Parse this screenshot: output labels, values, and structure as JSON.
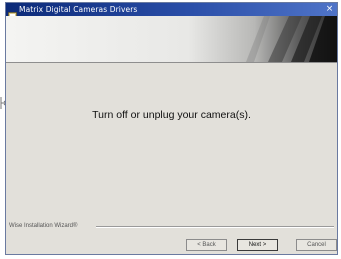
{
  "window": {
    "title": "Matrix Digital Cameras Drivers",
    "close_glyph": "×"
  },
  "main": {
    "message": "Turn off or unplug your camera(s)."
  },
  "footer": {
    "label": "Wise Installation Wizard®"
  },
  "buttons": {
    "back": "< Back",
    "next": "Next >",
    "cancel": "Cancel"
  },
  "colors": {
    "titlebar_start": "#0c2a78",
    "titlebar_end": "#4f74c8",
    "dialog_bg": "#e2e0da"
  },
  "icons": {
    "title_icon": "installer-icon",
    "close_icon": "close-icon",
    "side_marker": "side-marker-icon"
  }
}
